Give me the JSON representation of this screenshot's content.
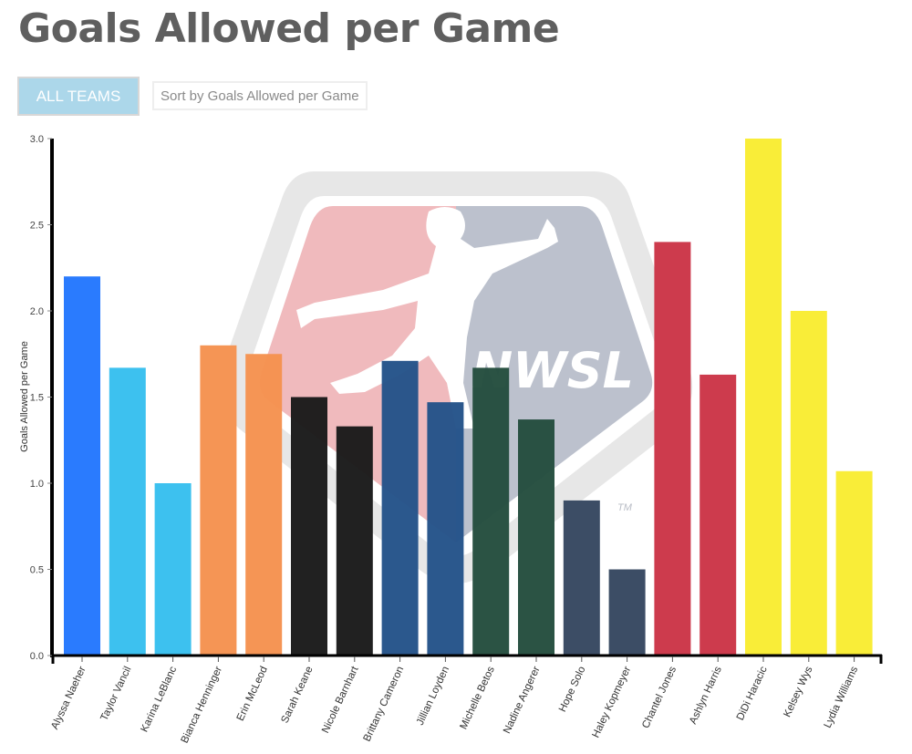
{
  "page": {
    "title": "Goals Allowed per Game"
  },
  "controls": {
    "team_button_label": "ALL TEAMS",
    "sort_selected": "Sort by Goals Allowed per Game"
  },
  "logo": {
    "text": "NWSL",
    "trademark": "TM"
  },
  "chart_data": {
    "type": "bar",
    "title": "Goals Allowed per Game",
    "xlabel": "",
    "ylabel": "Goals Allowed per Game",
    "ylim": [
      0,
      3.0
    ],
    "yticks": [
      "0.0",
      "0.5",
      "1.0",
      "1.5",
      "2.0",
      "2.5",
      "3.0"
    ],
    "grid": false,
    "categories": [
      "Alyssa Naeher",
      "Taylor Vancil",
      "Karina LeBlanc",
      "Bianca Henninger",
      "Erin McLeod",
      "Sarah Keane",
      "Nicole Barnhart",
      "Brittany Cameron",
      "Jillian Loyden",
      "Michelle Betos",
      "Nadine Angerer",
      "Hope Solo",
      "Haley Kopmeyer",
      "Chantel Jones",
      "Ashlyn Harris",
      "DiDi Haracic",
      "Kelsey Wys",
      "Lydia Williams"
    ],
    "values": [
      2.2,
      1.67,
      1.0,
      1.8,
      1.75,
      1.5,
      1.33,
      1.71,
      1.47,
      1.67,
      1.37,
      0.9,
      0.5,
      2.4,
      1.63,
      3.0,
      2.0,
      1.07
    ],
    "colors": [
      "#2377fe",
      "#37bfee",
      "#37bfee",
      "#f5924f",
      "#f5924f",
      "#1a1a1a",
      "#1a1a1a",
      "#245389",
      "#245389",
      "#244d3e",
      "#244d3e",
      "#364760",
      "#364760",
      "#cb3547",
      "#cb3547",
      "#f9ec32",
      "#f9ec32",
      "#f9ec32"
    ]
  }
}
